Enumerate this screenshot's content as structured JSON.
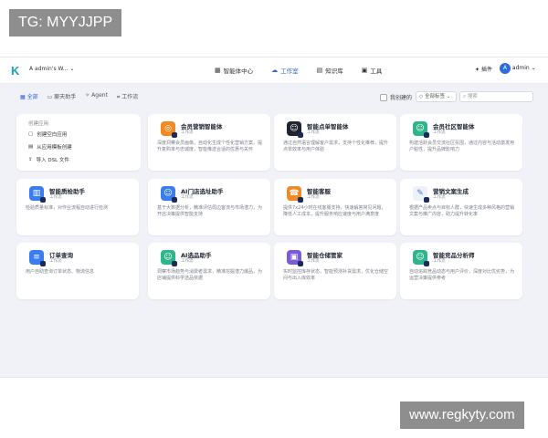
{
  "watermarks": {
    "top": "TG: MYYJJPP",
    "bottom": "www.regkyty.com"
  },
  "header": {
    "logo": "K",
    "workspace": "admin's W...",
    "nav": [
      {
        "label": "智能体中心",
        "icon": "grid-icon"
      },
      {
        "label": "工作室",
        "icon": "cloud-icon"
      },
      {
        "label": "知识库",
        "icon": "book-icon"
      },
      {
        "label": "工具",
        "icon": "briefcase-icon"
      }
    ],
    "plugin_label": "插件",
    "user_initial": "A",
    "user_name": "admin"
  },
  "filters": {
    "items": [
      "全部",
      "聊天助手",
      "Agent",
      "工作流"
    ],
    "mine_label": "我创建的",
    "tag_label": "全部标签",
    "search_placeholder": "搜索"
  },
  "create": {
    "title": "创建应用",
    "options": [
      "创建空白应用",
      "从应用模板创建",
      "导入 DSL 文件"
    ]
  },
  "colors": {
    "accent": "#2b5fd9",
    "icon_orange": "#f08a24",
    "icon_blue": "#3a7df0",
    "icon_green": "#2fb58a",
    "icon_purple": "#7b5cd6"
  },
  "agents": [
    {
      "name": "会员营销智能体",
      "type": "工作流",
      "desc": "深度洞察会员画像，自动化生成个性化营销方案，提升复购率与忠诚度，智能推送合适的优惠与关怀",
      "color": "#f08a24",
      "icon": "target-icon"
    },
    {
      "name": "智能点单智能体",
      "type": "工作流",
      "desc": "通过自然语言理解客户需求，支持个性化推荐，提升点单效率与用户体验",
      "color": "#1f2430",
      "icon": "robot-icon"
    },
    {
      "name": "会员社区智能体",
      "type": "工作流",
      "desc": "构建活跃会员交流社区氛围，通过内容与活动激发用户粘性，提升品牌影响力",
      "color": "#2fb58a",
      "icon": "robot-icon"
    },
    {
      "name": "智能质检助手",
      "type": "工作流",
      "desc": "检验质量标准，对作业流程自动进行检测",
      "color": "#3a7df0",
      "icon": "chart-icon"
    },
    {
      "name": "AI门店选址助手",
      "type": "工作流",
      "desc": "基于大数据分析，精准评估周边客流与市场潜力，为开店决策提供智能支持",
      "color": "#3a7df0",
      "icon": "robot-icon"
    },
    {
      "name": "智能客服",
      "type": "工作流",
      "desc": "提供7x24小时在线客服支持，快速解答常见问题，降低人工成本，提升服务响应速度与用户满意度",
      "color": "#f08a24",
      "icon": "headset-icon"
    },
    {
      "name": "营销文案生成",
      "type": "工作流",
      "desc": "根据产品卖点与目标人群，快速生成多种风格的营销文案与推广内容，助力提升转化率",
      "color": "#ffffff",
      "icon": "pen-icon"
    },
    {
      "name": "订单查询",
      "type": "工作流",
      "desc": "用户自助查询订单状态、物流信息",
      "color": "#3a7df0",
      "icon": "list-icon"
    },
    {
      "name": "AI选品助手",
      "type": "工作流",
      "desc": "洞察市场趋势与消费者需求，精准挖掘潜力爆品，为店铺提供科学选品依据",
      "color": "#2fb58a",
      "icon": "robot-icon"
    },
    {
      "name": "智能仓储管家",
      "type": "工作流",
      "desc": "实时监控库存状态，智能预测补货需求，优化仓储空间与出入库效率",
      "color": "#7b5cd6",
      "icon": "box-icon"
    },
    {
      "name": "智能竞品分析师",
      "type": "工作流",
      "desc": "自动追踪竞品动态与用户评价，深度对比优劣势，为运营决策提供参考",
      "color": "#2fb58a",
      "icon": "robot-icon"
    }
  ]
}
